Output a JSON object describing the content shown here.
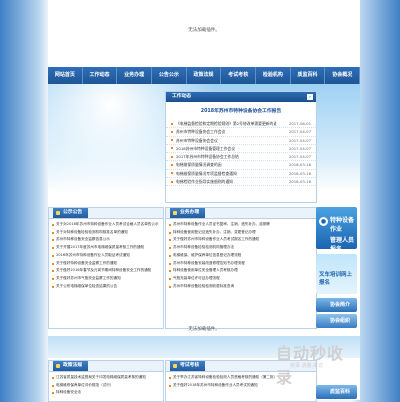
{
  "page": {
    "broken_image_top": "无法加载插件。",
    "broken_image_mid": "无法加载插件。"
  },
  "nav": [
    "网站首页",
    "工作动态",
    "业务办理",
    "公告公示",
    "政策法规",
    "考试考核",
    "检验机构",
    "质监百科",
    "协会概况"
  ],
  "work_news": {
    "title": "工作动态",
    "headline": "2018年苏州市特种设备协会工作报告",
    "items": [
      {
        "text": "《电梯监督检验和定期检验规则》第2号修改单需要更新的通知",
        "date": "2017-06-01"
      },
      {
        "text": "苏州市特种设备协会工作会议",
        "date": "2017-04-07"
      },
      {
        "text": "苏州市特种设备协会会议",
        "date": "2017-04-07"
      },
      {
        "text": "2018苏州市特种设备管理工作会议",
        "date": "2017-04-07"
      },
      {
        "text": "2017年苏州市特种设备协会工作总结",
        "date": "2017-04-07"
      },
      {
        "text": "电梯维保质量情况调查的函",
        "date": "2016-03-16"
      },
      {
        "text": "电梯维保质量情况专项监督检查通知",
        "date": "2016-03-16"
      },
      {
        "text": "电梯检验作业指导实施细则的通知",
        "date": "2016-03-16"
      }
    ]
  },
  "notices": {
    "title": "公示公告",
    "items": [
      "关于对2016年苏州市特种设备作业人员考试合格人员名单的公示",
      "关于对特种设备检验检测机构核准名单的通知",
      "苏州市特种设备安全监察信息公示",
      "关于开展2017年度苏州市电梯维保质量考核工作的通知",
      "2016年苏州市特种设备作业人员取证考试通知",
      "关于做好特种设备安全监察工作的通知",
      "关于做好2016年春节及元宵节期间特种设备安全工作的通知",
      "关于做好苏州市气瓶安全监察工作的通知",
      "关于公布电梯维保单位检查结果的公告"
    ]
  },
  "services": {
    "title": "业务办理",
    "items": [
      "苏州市特种设备作业人员证书复审、注销、遗失补办、延期等",
      "特种设备使用登记证遗失补办、注销、变更登记办理",
      "关于做好苏州市特种设备作业人员考试报名工作的通知",
      "苏州市特种设备检验检测机构管理办法",
      "电梯维保、维护保养单位信息登记办理流程",
      "苏州市特种设备安装改造修理告知书办理流程",
      "特种设备使用单位安全管理人员考核办理",
      "气瓶充装单位许可证办理流程",
      "苏州市特种设备检验检测收费标准查询"
    ]
  },
  "sidebar": {
    "exam_title": "特种设备作业",
    "exam_sub": "管理人员报名",
    "train_title": "叉车培训网上报名",
    "intro": "协会简介",
    "org": "协会组织",
    "baike": "质监百科"
  },
  "policy": {
    "title": "政策法规",
    "items": [
      "江苏省质量技术监督局关于印发电梯维保质量考核的通知",
      "电梯维修保养单位评价规范（试行）",
      "特种设备安全法"
    ]
  },
  "exam": {
    "title": "考试考核",
    "items": [
      "关于举办江苏省特种设备检验检测人员资格考核的通知（第二批）",
      "关于做好2018年苏州市特种设备作业人员考试的通知"
    ]
  },
  "watermark": {
    "main": "自动秒收录",
    "sub": "收录·流量·来访"
  }
}
